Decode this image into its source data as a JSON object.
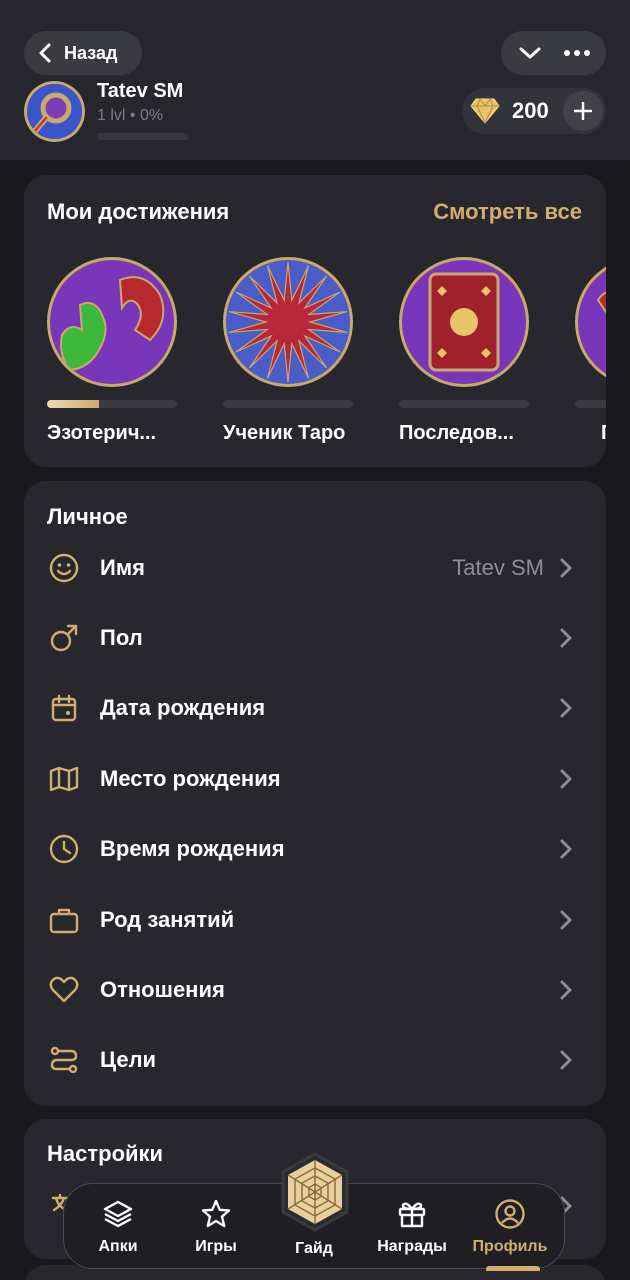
{
  "header": {
    "back_label": "Назад",
    "user_name": "Tatev SM",
    "user_level": "1 lvl • 0%",
    "level_progress": 0,
    "gems": "200"
  },
  "achievements": {
    "title": "Мои достижения",
    "see_all": "Смотреть все",
    "items": [
      {
        "label": "Эзотерич...",
        "progress": 0.4
      },
      {
        "label": "Ученик Таро",
        "progress": 0
      },
      {
        "label": "Последов...",
        "progress": 0
      },
      {
        "label": "П",
        "progress": 0
      }
    ]
  },
  "personal": {
    "title": "Личное",
    "rows": [
      {
        "label": "Имя",
        "value": "Tatev SM",
        "icon": "smile-icon"
      },
      {
        "label": "Пол",
        "value": "",
        "icon": "male-icon"
      },
      {
        "label": "Дата рождения",
        "value": "",
        "icon": "calendar-icon"
      },
      {
        "label": "Место рождения",
        "value": "",
        "icon": "map-icon"
      },
      {
        "label": "Время рождения",
        "value": "",
        "icon": "clock-icon"
      },
      {
        "label": "Род занятий",
        "value": "",
        "icon": "briefcase-icon"
      },
      {
        "label": "Отношения",
        "value": "",
        "icon": "heart-icon"
      },
      {
        "label": "Цели",
        "value": "",
        "icon": "route-icon"
      }
    ]
  },
  "settings": {
    "title": "Настройки"
  },
  "nav": {
    "items": [
      {
        "label": "Апки",
        "icon": "layers-icon"
      },
      {
        "label": "Игры",
        "icon": "star-icon"
      },
      {
        "label": "Гайд",
        "icon": "web-hexagon-icon"
      },
      {
        "label": "Награды",
        "icon": "gift-icon"
      },
      {
        "label": "Профиль",
        "icon": "profile-icon"
      }
    ],
    "active": "Профиль"
  },
  "colors": {
    "accent": "#d2ad6f",
    "background": "#18181d",
    "card": "#27272d"
  }
}
